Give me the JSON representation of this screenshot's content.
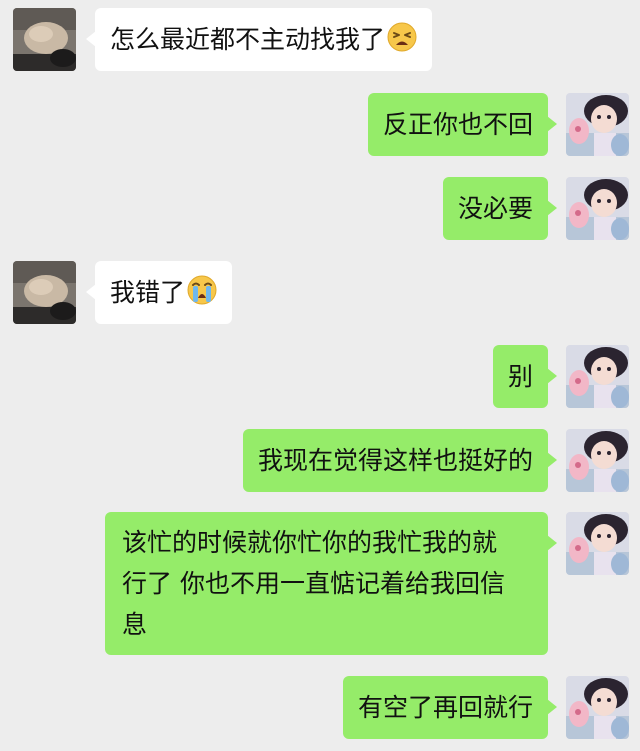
{
  "messages": [
    {
      "side": "in",
      "text": "怎么最近都不主动找我了",
      "emoji": "tired-face"
    },
    {
      "side": "out",
      "text": "反正你也不回"
    },
    {
      "side": "out",
      "text": "没必要"
    },
    {
      "side": "in",
      "text": "我错了",
      "emoji": "loudly-crying-face"
    },
    {
      "side": "out",
      "text": "别"
    },
    {
      "side": "out",
      "text": "我现在觉得这样也挺好的"
    },
    {
      "side": "out",
      "lines": [
        "该忙的时候就你忙你的我忙我的就",
        "行了 你也不用一直惦记着给我回信",
        "息"
      ]
    },
    {
      "side": "out",
      "text": "有空了再回就行"
    }
  ],
  "colors": {
    "background": "#ededed",
    "incoming_bubble": "#ffffff",
    "outgoing_bubble": "#95ec69"
  },
  "icons": {
    "incoming_avatar": "contact-avatar-photo",
    "outgoing_avatar": "user-avatar-photo"
  }
}
